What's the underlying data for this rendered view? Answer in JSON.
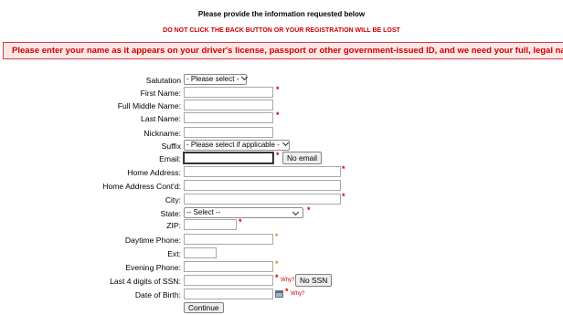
{
  "header": {
    "intro": "Please provide the information requested below",
    "warning": "DO NOT CLICK THE BACK BUTTON OR YOUR REGISTRATION WILL BE LOST",
    "notice": "Please enter your name as it appears on your driver's license, passport or other government-issued ID, and we need your full, legal name."
  },
  "form": {
    "salutation": {
      "label": "Salutation",
      "value": "- Please select -"
    },
    "first_name": {
      "label": "First Name:",
      "value": ""
    },
    "full_middle_name": {
      "label": "Full Middle Name:",
      "value": ""
    },
    "last_name": {
      "label": "Last Name:",
      "value": ""
    },
    "nickname": {
      "label": "Nickname:",
      "value": ""
    },
    "suffix": {
      "label": "Suffix",
      "value": "- Please select if applicable -"
    },
    "email": {
      "label": "Email:",
      "value": "",
      "no_email_button": "No email"
    },
    "home_address": {
      "label": "Home Address:",
      "value": ""
    },
    "home_address_2": {
      "label": "Home Address Cont'd:",
      "value": ""
    },
    "city": {
      "label": "City:",
      "value": ""
    },
    "state": {
      "label": "State:",
      "value": "-- Select --"
    },
    "zip": {
      "label": "ZIP:",
      "value": ""
    },
    "daytime_phone": {
      "label": "Daytime Phone:",
      "value": ""
    },
    "ext": {
      "label": "Ext:",
      "value": ""
    },
    "evening_phone": {
      "label": "Evening Phone:",
      "value": ""
    },
    "ssn_last4": {
      "label": "Last 4 digits of SSN:",
      "value": "",
      "why": "Why?",
      "no_ssn_button": "No SSN"
    },
    "dob": {
      "label": "Date of Birth:",
      "value": "",
      "why": "Why?"
    },
    "required_mark": "*",
    "continue_button": "Continue"
  },
  "colors": {
    "required": "#d00000",
    "optional_required": "#e08a30",
    "notice_text": "#cc0000",
    "notice_bg": "#ffe6e6"
  },
  "icons": {
    "calendar": "calendar-icon",
    "dropdown": "chevron-down-icon"
  }
}
